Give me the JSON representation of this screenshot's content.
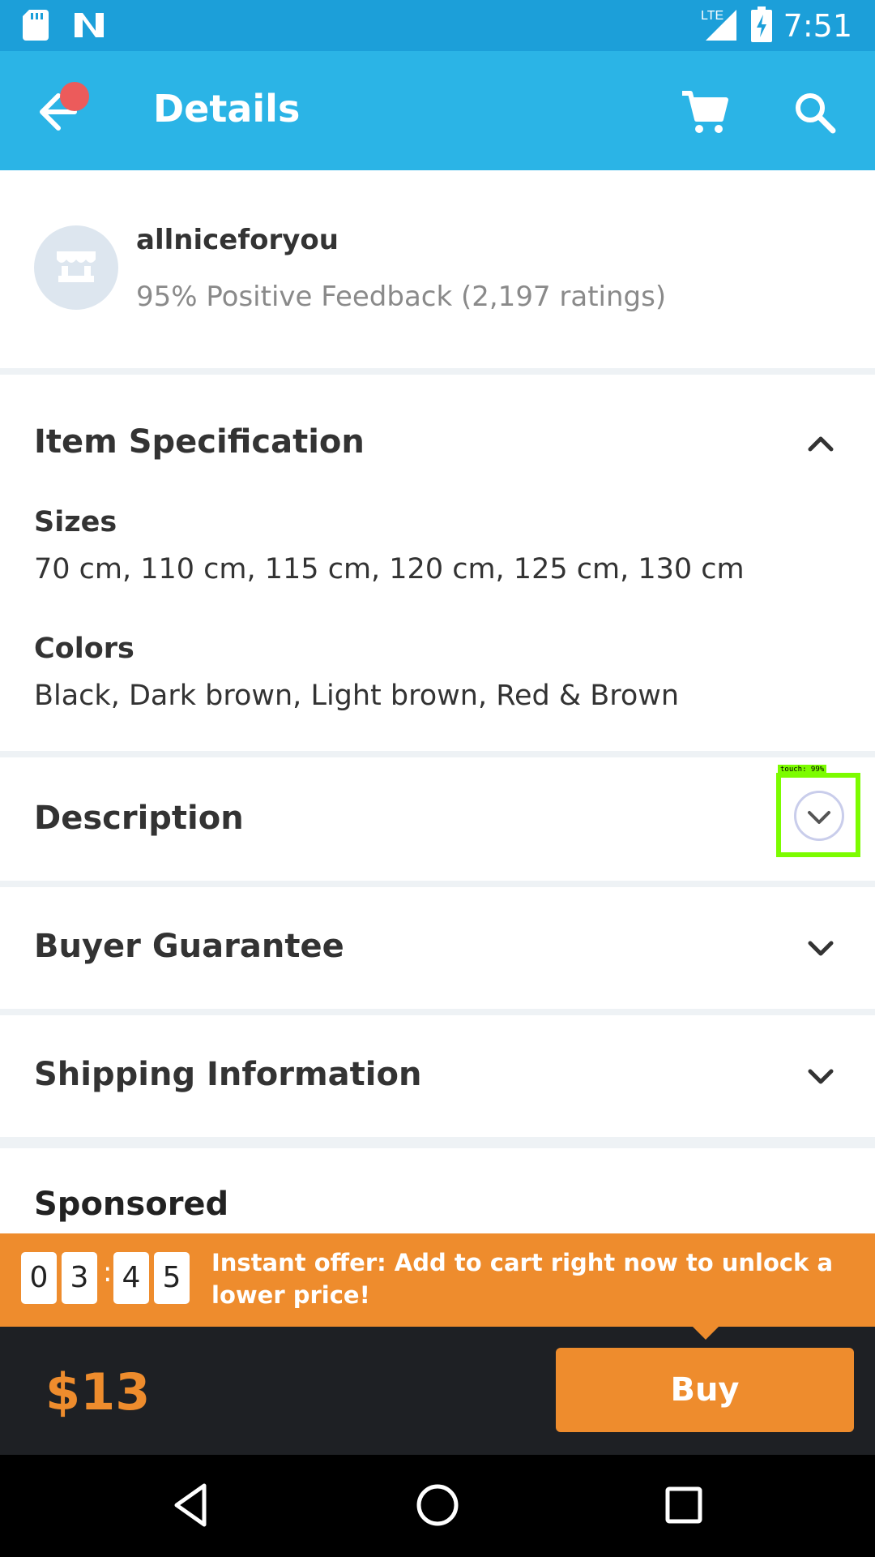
{
  "status_bar": {
    "time": "7:51",
    "network": "LTE",
    "icons": [
      "sd-card-icon",
      "n-logo-icon",
      "lte-signal-icon",
      "battery-charging-icon"
    ]
  },
  "app_bar": {
    "title": "Details",
    "icons": [
      "back-arrow-icon",
      "notification-dot",
      "cart-icon",
      "search-icon"
    ]
  },
  "seller": {
    "name": "allniceforyou",
    "feedback": "95% Positive Feedback (2,197 ratings)",
    "avatar_icon": "store-icon"
  },
  "item_specification": {
    "title": "Item Specification",
    "expanded": true,
    "specs": [
      {
        "label": "Sizes",
        "value": "70 cm, 110 cm, 115 cm, 120 cm, 125 cm, 130 cm"
      },
      {
        "label": "Colors",
        "value": "Black, Dark brown, Light brown, Red & Brown"
      }
    ]
  },
  "sections": [
    {
      "title": "Description",
      "expanded": false
    },
    {
      "title": "Buyer Guarantee",
      "expanded": false
    },
    {
      "title": "Shipping Information",
      "expanded": false
    }
  ],
  "touch_overlay": {
    "label": "touch: 99%"
  },
  "sponsored": {
    "title": "Sponsored"
  },
  "offer": {
    "timer_digits": [
      "0",
      "3",
      "4",
      "5"
    ],
    "separator": ":",
    "text": "Instant offer: Add to cart right now to unlock a lower price!"
  },
  "buy_bar": {
    "price": "$13",
    "buy_label": "Buy"
  },
  "colors": {
    "status_bar": "#1C9FD9",
    "app_bar": "#2BB4E6",
    "accent_orange": "#EE8C2D",
    "notification_dot": "#EC5B5B",
    "buy_bar_bg": "#1E2024"
  },
  "nav_bar": {
    "icons": [
      "back-triangle-icon",
      "home-circle-icon",
      "recents-square-icon"
    ]
  }
}
